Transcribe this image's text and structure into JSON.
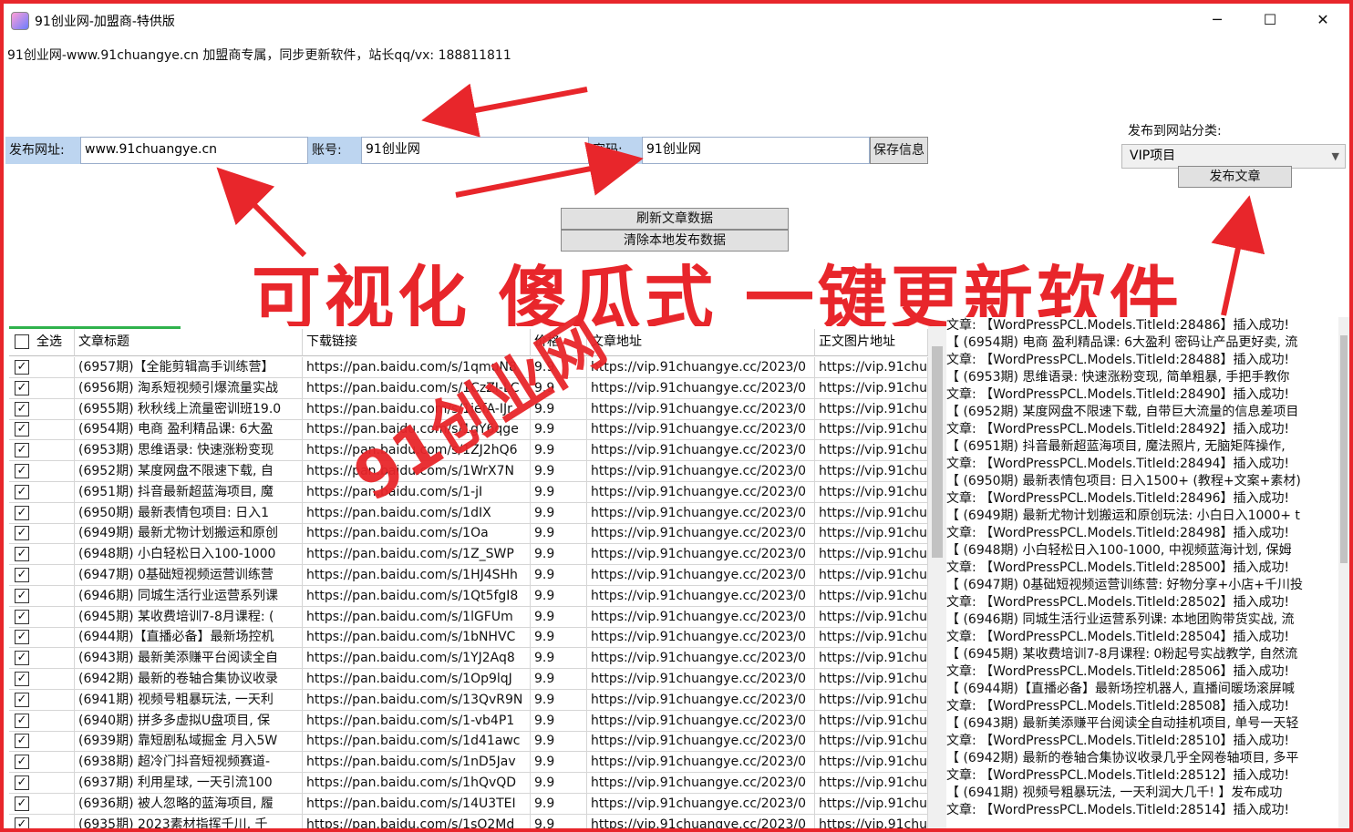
{
  "window": {
    "title": "91创业网-加盟商-特供版",
    "min": "─",
    "max": "☐",
    "close": "✕"
  },
  "info": "91创业网-www.91chuangye.cn  加盟商专属，同步更新软件，站长qq/vx: 188811811",
  "form": {
    "site_label": "发布网址:",
    "site_value": "www.91chuangye.cn",
    "account_label": "账号:",
    "account_value": "91创业网",
    "password_label": "密码:",
    "password_value": "91创业网",
    "save_button": "保存信息"
  },
  "category": {
    "label": "发布到网站分类:",
    "selected": "VIP项目",
    "publish_button": "发布文章"
  },
  "actions": {
    "refresh": "刷新文章数据",
    "clear": "清除本地发布数据"
  },
  "slogan": "可视化 傻瓜式 一键更新软件",
  "watermark": "91创业网",
  "table": {
    "headers": {
      "select_all": "全选",
      "title": "文章标题",
      "link": "下载链接",
      "price": "价格",
      "url": "文章地址",
      "img": "正文图片地址"
    },
    "rows": [
      {
        "title": "(6957期)【全能剪辑高手训练营】",
        "link": "https://pan.baidu.com/s/1qmuN8",
        "price": "9.9",
        "url": "https://vip.91chuangye.cc/2023/0",
        "img": "https://vip.91chu"
      },
      {
        "title": "(6956期) 淘系短视频引爆流量实战",
        "link": "https://pan.baidu.com/s/1CzZI-LC",
        "price": "9.9",
        "url": "https://vip.91chuangye.cc/2023/0",
        "img": "https://vip.91chu"
      },
      {
        "title": "(6955期) 秋秋线上流量密训班19.0",
        "link": "https://pan.baidu.com/s/1iefA-IJr",
        "price": "9.9",
        "url": "https://vip.91chuangye.cc/2023/0",
        "img": "https://vip.91chu"
      },
      {
        "title": "(6954期) 电商 盈利精品课: 6大盈",
        "link": "https://pan.baidu.com/s/1gY6qge",
        "price": "9.9",
        "url": "https://vip.91chuangye.cc/2023/0",
        "img": "https://vip.91chu"
      },
      {
        "title": "(6953期) 思维语录: 快速涨粉变现",
        "link": "https://pan.baidu.com/s/1ZJ2hQ6",
        "price": "9.9",
        "url": "https://vip.91chuangye.cc/2023/0",
        "img": "https://vip.91chu"
      },
      {
        "title": "(6952期) 某度网盘不限速下载, 自",
        "link": "https://pan.baidu.com/s/1WrX7N",
        "price": "9.9",
        "url": "https://vip.91chuangye.cc/2023/0",
        "img": "https://vip.91chu"
      },
      {
        "title": "(6951期) 抖音最新超蓝海项目, 魔",
        "link": "https://pan.baidu.com/s/1-jI",
        "price": "9.9",
        "url": "https://vip.91chuangye.cc/2023/0",
        "img": "https://vip.91chu"
      },
      {
        "title": "(6950期) 最新表情包项目: 日入1",
        "link": "https://pan.baidu.com/s/1dIX",
        "price": "9.9",
        "url": "https://vip.91chuangye.cc/2023/0",
        "img": "https://vip.91chu"
      },
      {
        "title": "(6949期) 最新尤物计划搬运和原创",
        "link": "https://pan.baidu.com/s/1Oa",
        "price": "9.9",
        "url": "https://vip.91chuangye.cc/2023/0",
        "img": "https://vip.91chu"
      },
      {
        "title": "(6948期) 小白轻松日入100-1000",
        "link": "https://pan.baidu.com/s/1Z_SWP",
        "price": "9.9",
        "url": "https://vip.91chuangye.cc/2023/0",
        "img": "https://vip.91chu"
      },
      {
        "title": "(6947期) 0基础短视频运营训练营",
        "link": "https://pan.baidu.com/s/1HJ4SHh",
        "price": "9.9",
        "url": "https://vip.91chuangye.cc/2023/0",
        "img": "https://vip.91chu"
      },
      {
        "title": "(6946期) 同城生活行业运营系列课",
        "link": "https://pan.baidu.com/s/1Qt5fgI8",
        "price": "9.9",
        "url": "https://vip.91chuangye.cc/2023/0",
        "img": "https://vip.91chu"
      },
      {
        "title": "(6945期) 某收费培训7-8月课程: (",
        "link": "https://pan.baidu.com/s/1lGFUm",
        "price": "9.9",
        "url": "https://vip.91chuangye.cc/2023/0",
        "img": "https://vip.91chu"
      },
      {
        "title": "(6944期)【直播必备】最新场控机",
        "link": "https://pan.baidu.com/s/1bNHVC",
        "price": "9.9",
        "url": "https://vip.91chuangye.cc/2023/0",
        "img": "https://vip.91chu"
      },
      {
        "title": "(6943期) 最新美添赚平台阅读全自",
        "link": "https://pan.baidu.com/s/1YJ2Aq8",
        "price": "9.9",
        "url": "https://vip.91chuangye.cc/2023/0",
        "img": "https://vip.91chu"
      },
      {
        "title": "(6942期) 最新的卷轴合集协议收录",
        "link": "https://pan.baidu.com/s/1Op9lqJ",
        "price": "9.9",
        "url": "https://vip.91chuangye.cc/2023/0",
        "img": "https://vip.91chu"
      },
      {
        "title": "(6941期) 视频号粗暴玩法, 一天利",
        "link": "https://pan.baidu.com/s/13QvR9N",
        "price": "9.9",
        "url": "https://vip.91chuangye.cc/2023/0",
        "img": "https://vip.91chu"
      },
      {
        "title": "(6940期) 拼多多虚拟U盘项目, 保",
        "link": "https://pan.baidu.com/s/1-vb4P1",
        "price": "9.9",
        "url": "https://vip.91chuangye.cc/2023/0",
        "img": "https://vip.91chu"
      },
      {
        "title": "(6939期) 靠短剧私域掘金 月入5W",
        "link": "https://pan.baidu.com/s/1d41awc",
        "price": "9.9",
        "url": "https://vip.91chuangye.cc/2023/0",
        "img": "https://vip.91chu"
      },
      {
        "title": "(6938期) 超冷门抖音短视频赛道-",
        "link": "https://pan.baidu.com/s/1nD5Jav",
        "price": "9.9",
        "url": "https://vip.91chuangye.cc/2023/0",
        "img": "https://vip.91chu"
      },
      {
        "title": "(6937期) 利用星球, 一天引流100",
        "link": "https://pan.baidu.com/s/1hQvQD",
        "price": "9.9",
        "url": "https://vip.91chuangye.cc/2023/0",
        "img": "https://vip.91chu"
      },
      {
        "title": "(6936期) 被人忽略的蓝海项目, 履",
        "link": "https://pan.baidu.com/s/14U3TEI",
        "price": "9.9",
        "url": "https://vip.91chuangye.cc/2023/0",
        "img": "https://vip.91chu"
      },
      {
        "title": "(6935期) 2023素材指挥千川, 千",
        "link": "https://pan.baidu.com/s/1sO2Md",
        "price": "9.9",
        "url": "https://vip.91chuangye.cc/2023/0",
        "img": "https://vip.91chu"
      }
    ]
  },
  "log": [
    "文章: 【WordPressPCL.Models.TitleId:28486】插入成功!",
    "【 (6954期) 电商 盈利精品课: 6大盈利 密码让产品更好卖, 流",
    "文章: 【WordPressPCL.Models.TitleId:28488】插入成功!",
    "【 (6953期) 思维语录: 快速涨粉变现, 简单粗暴, 手把手教你",
    "文章: 【WordPressPCL.Models.TitleId:28490】插入成功!",
    "【 (6952期) 某度网盘不限速下载, 自带巨大流量的信息差项目",
    "文章: 【WordPressPCL.Models.TitleId:28492】插入成功!",
    "【 (6951期) 抖音最新超蓝海项目, 魔法照片, 无脑矩阵操作,",
    "文章: 【WordPressPCL.Models.TitleId:28494】插入成功!",
    "【 (6950期) 最新表情包项目: 日入1500+ (教程+文案+素材)",
    "文章: 【WordPressPCL.Models.TitleId:28496】插入成功!",
    "【 (6949期) 最新尤物计划搬运和原创玩法: 小白日入1000+ t",
    "文章: 【WordPressPCL.Models.TitleId:28498】插入成功!",
    "【 (6948期) 小白轻松日入100-1000, 中视频蓝海计划, 保姆",
    "文章: 【WordPressPCL.Models.TitleId:28500】插入成功!",
    "【 (6947期) 0基础短视频运营训练营: 好物分享+小店+千川投",
    "文章: 【WordPressPCL.Models.TitleId:28502】插入成功!",
    "【 (6946期) 同城生活行业运营系列课: 本地团购带货实战, 流",
    "文章: 【WordPressPCL.Models.TitleId:28504】插入成功!",
    "【 (6945期) 某收费培训7-8月课程: 0粉起号实战教学, 自然流",
    "文章: 【WordPressPCL.Models.TitleId:28506】插入成功!",
    "【 (6944期)【直播必备】最新场控机器人, 直播间暖场滚屏喊",
    "文章: 【WordPressPCL.Models.TitleId:28508】插入成功!",
    "【 (6943期) 最新美添赚平台阅读全自动挂机项目, 单号一天轻",
    "文章: 【WordPressPCL.Models.TitleId:28510】插入成功!",
    "【 (6942期) 最新的卷轴合集协议收录几乎全网卷轴项目, 多平",
    "文章: 【WordPressPCL.Models.TitleId:28512】插入成功!",
    "【 (6941期) 视频号粗暴玩法, 一天利润大几千! 】发布成功",
    "文章: 【WordPressPCL.Models.TitleId:28514】插入成功!"
  ]
}
